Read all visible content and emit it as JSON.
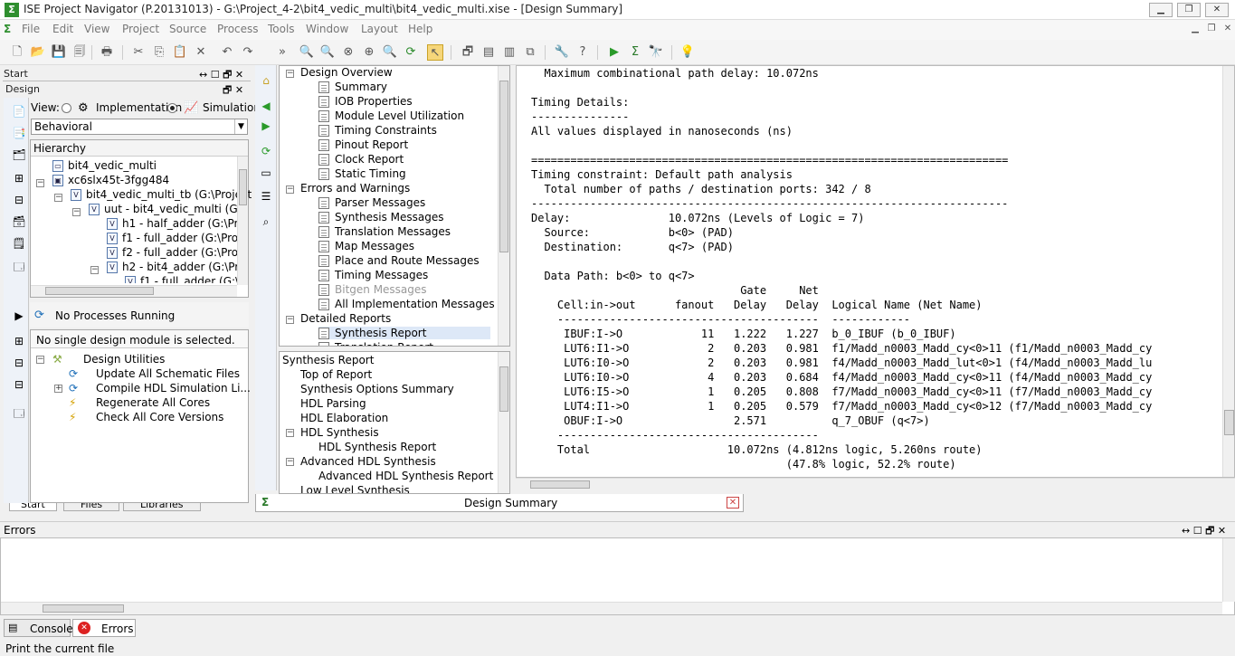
{
  "window": {
    "title": "ISE Project Navigator (P.20131013) - G:\\Project_4-2\\bit4_vedic_multi\\bit4_vedic_multi.xise - [Design Summary]"
  },
  "menu": [
    "File",
    "Edit",
    "View",
    "Project",
    "Source",
    "Process",
    "Tools",
    "Window",
    "Layout",
    "Help"
  ],
  "start_panel": {
    "title": "Start"
  },
  "design_panel": {
    "title": "Design",
    "view_label": "View:",
    "view_options": [
      "Implementation",
      "Simulation"
    ],
    "selected_view": "Simulation",
    "behavior_select": "Behavioral",
    "hierarchy_header": "Hierarchy",
    "tree": [
      "bit4_vedic_multi",
      "xc6slx45t-3fgg484",
      "bit4_vedic_multi_tb (G:\\Project",
      "uut - bit4_vedic_multi (G:\\",
      "h1 - half_adder (G:\\Pro",
      "f1 - full_adder (G:\\Proj",
      "f2 - full_adder (G:\\Proj",
      "h2 - bit4_adder (G:\\Pro",
      "f1 - full_adder (G:\\P"
    ]
  },
  "processes": {
    "status": "No Processes Running",
    "no_module": "No single design module is selected.",
    "group": "Design Utilities",
    "items": [
      "Update All Schematic Files",
      "Compile HDL Simulation Li...",
      "Regenerate All Cores",
      "Check All Core Versions"
    ]
  },
  "bottom_tabs_left": [
    "Start",
    "Files",
    "Libraries"
  ],
  "design_overview": {
    "sections": [
      {
        "label": "Design Overview",
        "items": [
          "Summary",
          "IOB Properties",
          "Module Level Utilization",
          "Timing Constraints",
          "Pinout Report",
          "Clock Report",
          "Static Timing"
        ]
      },
      {
        "label": "Errors and Warnings",
        "items": [
          "Parser Messages",
          "Synthesis Messages",
          "Translation Messages",
          "Map Messages",
          "Place and Route Messages",
          "Timing Messages",
          "Bitgen Messages",
          "All Implementation Messages"
        ]
      },
      {
        "label": "Detailed Reports",
        "items": [
          "Synthesis Report",
          "Translation Report"
        ]
      }
    ]
  },
  "synthesis_report_nav": {
    "header": "Synthesis Report",
    "items": [
      "Top of Report",
      "Synthesis Options Summary",
      "HDL Parsing",
      "HDL Elaboration",
      "HDL Synthesis",
      "HDL Synthesis Report",
      "Advanced HDL Synthesis",
      "Advanced HDL Synthesis Report",
      "Low Level Synthesis"
    ]
  },
  "tab_design_summary": "Design Summary",
  "report_lines": [
    "  Maximum combinational path delay: 10.072ns",
    "",
    "Timing Details:",
    "---------------",
    "All values displayed in nanoseconds (ns)",
    "",
    "=========================================================================",
    "Timing constraint: Default path analysis",
    "  Total number of paths / destination ports: 342 / 8",
    "-------------------------------------------------------------------------",
    "Delay:               10.072ns (Levels of Logic = 7)",
    "  Source:            b<0> (PAD)",
    "  Destination:       q<7> (PAD)",
    "",
    "  Data Path: b<0> to q<7>",
    "                                Gate     Net",
    "    Cell:in->out      fanout   Delay   Delay  Logical Name (Net Name)",
    "    ----------------------------------------  ------------",
    "     IBUF:I->O            11   1.222   1.227  b_0_IBUF (b_0_IBUF)",
    "     LUT6:I1->O            2   0.203   0.981  f1/Madd_n0003_Madd_cy<0>11 (f1/Madd_n0003_Madd_cy",
    "     LUT6:I0->O            2   0.203   0.981  f4/Madd_n0003_Madd_lut<0>1 (f4/Madd_n0003_Madd_lu",
    "     LUT6:I0->O            4   0.203   0.684  f4/Madd_n0003_Madd_cy<0>11 (f4/Madd_n0003_Madd_cy",
    "     LUT6:I5->O            1   0.205   0.808  f7/Madd_n0003_Madd_cy<0>11 (f7/Madd_n0003_Madd_cy",
    "     LUT4:I1->O            1   0.205   0.579  f7/Madd_n0003_Madd_cy<0>12 (f7/Madd_n0003_Madd_cy",
    "     OBUF:I->O                 2.571          q_7_OBUF (q<7>)",
    "    ----------------------------------------",
    "    Total                     10.072ns (4.812ns logic, 5.260ns route)",
    "                                       (47.8% logic, 52.2% route)"
  ],
  "errors_panel": {
    "title": "Errors"
  },
  "bottom_tabs": [
    "Console",
    "Errors"
  ],
  "status_text": "Print the current file"
}
